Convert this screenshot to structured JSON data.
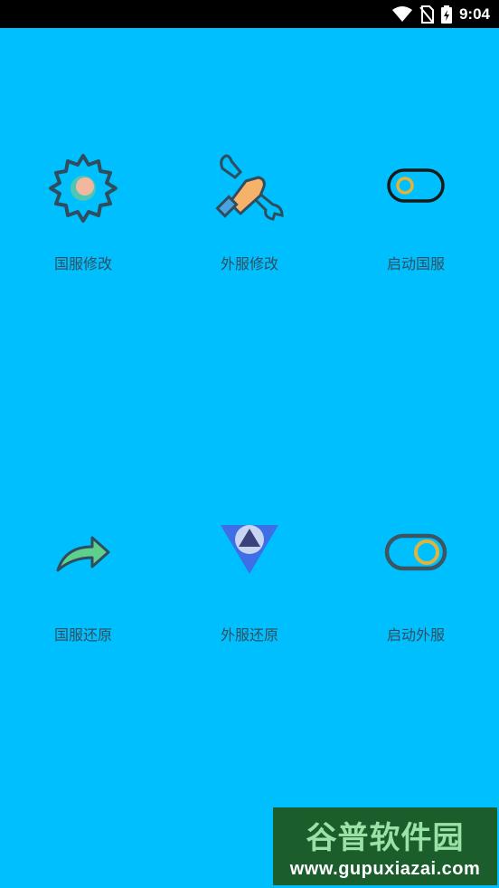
{
  "status": {
    "time": "9:04"
  },
  "tiles": [
    {
      "label": "国服修改",
      "icon": "gear-icon"
    },
    {
      "label": "外服修改",
      "icon": "wrench-icon"
    },
    {
      "label": "启动国服",
      "icon": "toggle-off-icon"
    },
    {
      "label": "国服还原",
      "icon": "share-arrow-icon"
    },
    {
      "label": "外服还原",
      "icon": "triangle-logo-icon"
    },
    {
      "label": "启动外服",
      "icon": "toggle-on-icon"
    }
  ],
  "watermark": {
    "title": "谷普软件园",
    "url": "www.gupuxiazai.com"
  },
  "colors": {
    "background": "#00BFFF",
    "label": "#2f4f5f"
  }
}
